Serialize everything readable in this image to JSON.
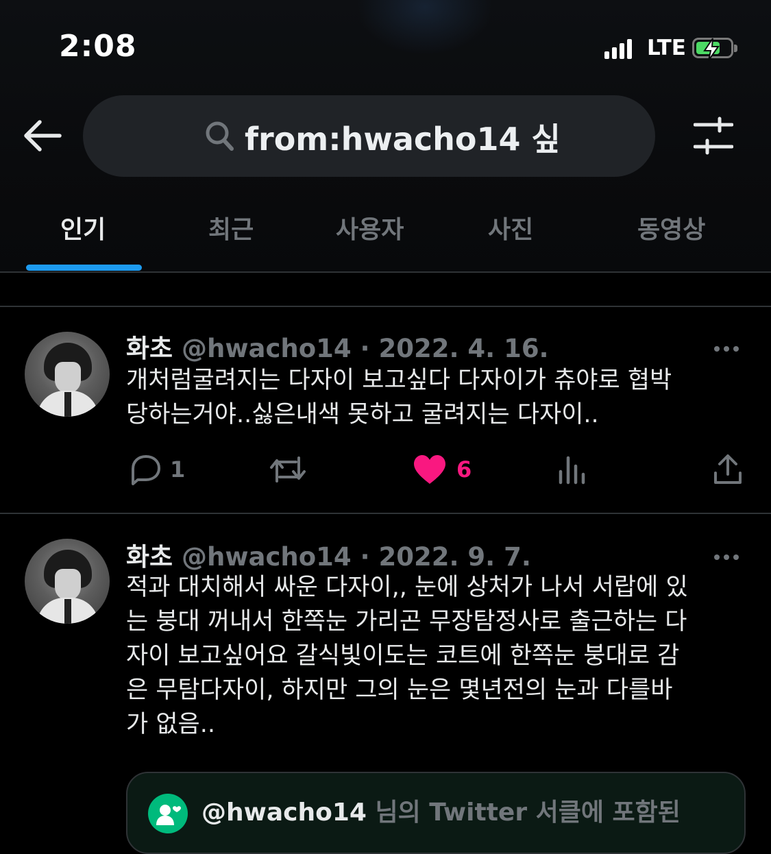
{
  "status_bar": {
    "time": "2:08",
    "network": "LTE"
  },
  "search": {
    "query": "from:hwacho14 싶"
  },
  "tabs": [
    {
      "label": "인기",
      "active": true
    },
    {
      "label": "최근",
      "active": false
    },
    {
      "label": "사용자",
      "active": false
    },
    {
      "label": "사진",
      "active": false
    },
    {
      "label": "동영상",
      "active": false
    }
  ],
  "tweets": [
    {
      "name": "화초",
      "meta": "@hwacho14 · 2022. 4. 16.",
      "text": "개처럼굴려지는 다자이 보고싶다 다자이가 츄야로 협박\n당하는거야..싫은내색 못하고 굴려지는 다자이..",
      "reply_count": "1",
      "like_count": "6",
      "liked": true
    },
    {
      "name": "화초",
      "meta": "@hwacho14 · 2022. 9. 7.",
      "text": "적과 대치해서 싸운 다자이,, 눈에 상처가 나서 서랍에 있\n는 붕대 꺼내서 한쪽눈 가리곤 무장탐정사로 출근하는 다\n자이 보고싶어요 갈식빛이도는 코트에 한쪽눈 붕대로 감\n은 무탐다자이, 하지만 그의 눈은 몇년전의 눈과 다를바\n가 없음.."
    }
  ],
  "circle_card": {
    "handle": "@hwacho14",
    "rest": " 님의 Twitter 서클에 포함된"
  },
  "colors": {
    "accent": "#1d9bf0",
    "like": "#f91880",
    "background": "#000000",
    "circle": "#00ba7c"
  }
}
